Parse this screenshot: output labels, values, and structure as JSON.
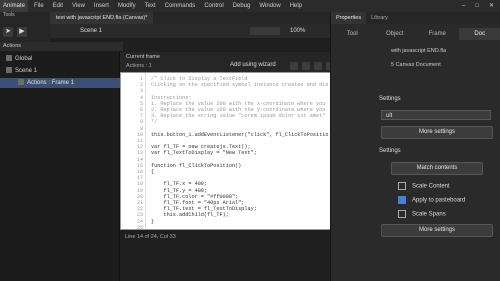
{
  "menubar": {
    "brand": "Animate",
    "items": [
      "File",
      "Edit",
      "View",
      "Insert",
      "Modify",
      "Text",
      "Commands",
      "Control",
      "Debug",
      "Window",
      "Help"
    ]
  },
  "document_tab": "text with javascript END.fla (Canvas)*",
  "tools_label": "Tools",
  "scene": {
    "name": "Scene 1",
    "zoom": "100%"
  },
  "actions_panel": {
    "title": "Actions",
    "tree": [
      {
        "label": "Global"
      },
      {
        "label": "Scene 1"
      },
      {
        "label": "Actions : Frame 1"
      }
    ]
  },
  "code_panel": {
    "current_frame_label": "Current frame",
    "layer_label": "Actions : 1",
    "wizard": "Add using wizard",
    "lines": [
      "/* Click to Display a TextField",
      "Clicking on the specified symbol instance creates and dis",
      "",
      "Instructions:",
      "1. Replace the value 200 with the x-coordinate where you",
      "2. Replace the value 100 with the y-coordinate where you",
      "3. Replace the string value \"Lorem ipsum dolor sit amet\"",
      "*/",
      "",
      "this.button_1.addEventListener(\"click\", fl_ClickToPositio",
      "",
      "var fl_TF = new createjs.Text();",
      "var fl_TextToDisplay = \"New Text\";",
      "",
      "function fl_ClickToPosition()",
      "{",
      "",
      "    fl_TF.x = 400;",
      "    fl_TF.y = 400;",
      "    fl_TF.color = \"#ff0000\";",
      "    fl_TF.font = \"40px Arial\";",
      "    fl_TF.text = fl_TextToDisplay;",
      "    this.addChild(fl_TF);",
      "}",
      ""
    ],
    "status": "Line 14 of 24, Col 33"
  },
  "properties": {
    "tabs": [
      "Properties",
      "Library"
    ],
    "subtabs": [
      "Tool",
      "Object",
      "Frame",
      "Doc"
    ],
    "doc_title": "with javascript END.fla",
    "doc_type": "5 Canvas Document",
    "settings_label": "Settings",
    "fps_value": "ult",
    "more_settings_1": "More settings",
    "settings2_label": "Settings",
    "match_contents": "Match contents",
    "scale_content": "Scale Content",
    "apply_pasteboard": "Apply to pasteboard",
    "scale_spans": "Scale Spans",
    "more_settings_2": "More settings"
  }
}
